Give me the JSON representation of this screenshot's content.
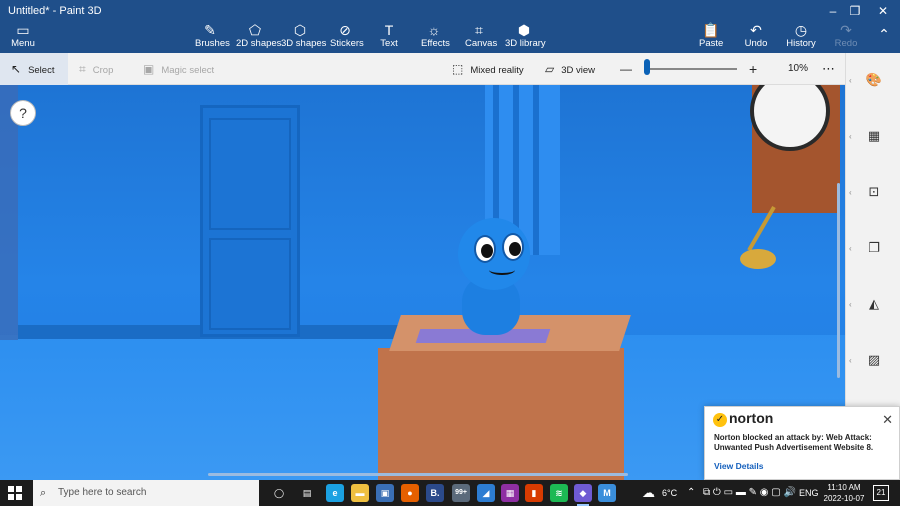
{
  "window": {
    "title": "Untitled* - Paint 3D",
    "controls": {
      "minimize": "–",
      "maximize": "❐",
      "close": "✕"
    }
  },
  "ribbon": {
    "menu": {
      "label": "Menu",
      "icon": "folder-icon"
    },
    "tools": [
      {
        "id": "brushes",
        "label": "Brushes",
        "icon": "✎"
      },
      {
        "id": "2d-shapes",
        "label": "2D shapes",
        "icon": "⬠"
      },
      {
        "id": "3d-shapes",
        "label": "3D shapes",
        "icon": "⬡"
      },
      {
        "id": "stickers",
        "label": "Stickers",
        "icon": "⊘"
      },
      {
        "id": "text",
        "label": "Text",
        "icon": "T"
      },
      {
        "id": "effects",
        "label": "Effects",
        "icon": "☼"
      },
      {
        "id": "canvas",
        "label": "Canvas",
        "icon": "⌗"
      },
      {
        "id": "3d-library",
        "label": "3D library",
        "icon": "⬢"
      }
    ],
    "actions": [
      {
        "id": "paste",
        "label": "Paste",
        "icon": "📋",
        "disabled": false
      },
      {
        "id": "undo",
        "label": "Undo",
        "icon": "↶",
        "disabled": false
      },
      {
        "id": "history",
        "label": "History",
        "icon": "◷",
        "disabled": false
      },
      {
        "id": "redo",
        "label": "Redo",
        "icon": "↷",
        "disabled": true
      }
    ],
    "collapse_icon": "⌃"
  },
  "toolbar": {
    "select": "Select",
    "crop": "Crop",
    "magic_select": "Magic select",
    "mixed_reality": "Mixed reality",
    "view_3d": "3D view",
    "zoom_minus": "—",
    "zoom_plus": "+",
    "zoom_value": "10%",
    "zoom_fraction": 0.02,
    "more": "⋯"
  },
  "canvas": {
    "help": "?"
  },
  "sidebar": {
    "icons": [
      "palette-icon",
      "grid-icon",
      "frame-icon",
      "copy-icon",
      "flip-icon",
      "hatch-icon"
    ],
    "glyphs": [
      "🎨",
      "▦",
      "⊡",
      "❐",
      "◭",
      "▨"
    ]
  },
  "notification": {
    "brand": "norton",
    "message": "Norton blocked an attack by: Web Attack: Unwanted Push Advertisement Website 8.",
    "link": "View Details",
    "close": "✕"
  },
  "taskbar": {
    "search_placeholder": "Type here to search",
    "apps": [
      {
        "name": "task-view",
        "glyph": "◯",
        "color": "#1c1c1c"
      },
      {
        "name": "widgets",
        "glyph": "▤",
        "color": "#1c1c1c"
      },
      {
        "name": "edge",
        "glyph": "e",
        "color": "#1ba1e2"
      },
      {
        "name": "file-explorer",
        "glyph": "▬",
        "color": "#f0c040"
      },
      {
        "name": "store",
        "glyph": "▣",
        "color": "#3a6fb5"
      },
      {
        "name": "firefox",
        "glyph": "●",
        "color": "#e66000"
      },
      {
        "name": "app-b",
        "glyph": "B.",
        "color": "#2b4a8b"
      },
      {
        "name": "mail-99",
        "glyph": "99+",
        "color": "#5b6a7b"
      },
      {
        "name": "whiteboard",
        "glyph": "◢",
        "color": "#2d7dd2"
      },
      {
        "name": "app-grid",
        "glyph": "▦",
        "color": "#8e2fa3"
      },
      {
        "name": "office",
        "glyph": "▮",
        "color": "#d83b01"
      },
      {
        "name": "spotify",
        "glyph": "≋",
        "color": "#1db954"
      },
      {
        "name": "paint-3d",
        "glyph": "◆",
        "color": "#6f5bd3",
        "active": true
      },
      {
        "name": "app-m",
        "glyph": "M",
        "color": "#3a8edb"
      }
    ],
    "weather": "6°C",
    "language": "ENG",
    "time": "11:10 AM",
    "date": "2022-10-07",
    "notifications": "21"
  }
}
